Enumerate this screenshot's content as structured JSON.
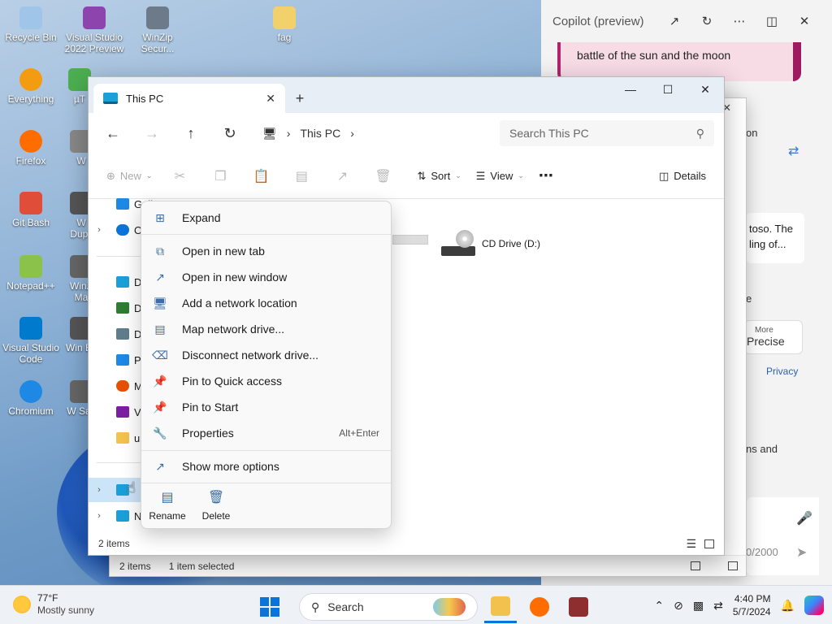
{
  "desktop": {
    "icons": [
      {
        "label": "Recycle Bin",
        "color": "#9fc5e8"
      },
      {
        "label": "Visual Studio 2022 Preview",
        "color": "#8e44ad"
      },
      {
        "label": "WinZip Secur...",
        "color": "#6c7a89"
      },
      {
        "label": "fag",
        "color": "#f2d16b"
      },
      {
        "label": "Everything",
        "color": "#f39c12"
      },
      {
        "label": "µT",
        "color": "#4caf50"
      },
      {
        "label": "Firefox",
        "color": "#ff6d00"
      },
      {
        "label": "W",
        "color": "#888888"
      },
      {
        "label": "Git Bash",
        "color": "#e04e39"
      },
      {
        "label": "W Dupli",
        "color": "#555555"
      },
      {
        "label": "Notepad++",
        "color": "#8bc34a"
      },
      {
        "label": "WinZ Ma",
        "color": "#666666"
      },
      {
        "label": "Visual Studio Code",
        "color": "#007acc"
      },
      {
        "label": "Win Ex",
        "color": "#555555"
      },
      {
        "label": "Chromium",
        "color": "#1e88e5"
      },
      {
        "label": "W Safi",
        "color": "#666666"
      }
    ]
  },
  "copilot": {
    "title": "Copilot (preview)",
    "message": "battle of the sun and the moon",
    "frag_on": "on",
    "frag_toso": "toso. The",
    "frag_ling": "ling of...",
    "frag_e": "e",
    "more_label": "More",
    "precise_label": "Precise",
    "privacy": "Privacy",
    "frag_ns": "ns and",
    "counter": "0/2000"
  },
  "background_window": {
    "status_items": "2 items",
    "status_selected": "1 item selected"
  },
  "explorer": {
    "tab_title": "This PC",
    "breadcrumb": "This PC",
    "search_placeholder": "Search This PC",
    "new_label": "New",
    "sort_label": "Sort",
    "view_label": "View",
    "details_label": "Details",
    "nav_items": [
      {
        "label": "Gall",
        "expander": "",
        "color": "#1e88e5"
      },
      {
        "label": "O",
        "expander": "›",
        "color": "#0a74da"
      },
      {
        "label": "D",
        "expander": "",
        "color": "#1b9fd8"
      },
      {
        "label": "D",
        "expander": "",
        "color": "#2e7d32"
      },
      {
        "label": "D",
        "expander": "",
        "color": "#607d8b"
      },
      {
        "label": "P",
        "expander": "",
        "color": "#1e88e5"
      },
      {
        "label": "M",
        "expander": "",
        "color": "#e65100"
      },
      {
        "label": "V",
        "expander": "",
        "color": "#7b1fa2"
      },
      {
        "label": "u",
        "expander": "",
        "color": "#f2c14e"
      },
      {
        "label": "",
        "expander": "›",
        "color": "#1b9fd8"
      },
      {
        "label": "N",
        "expander": "›",
        "color": "#1b9fd8"
      }
    ],
    "drive_label": "CD Drive (D:)",
    "status_items": "2 items"
  },
  "context_menu": {
    "expand": "Expand",
    "open_new_tab": "Open in new tab",
    "open_new_window": "Open in new window",
    "add_network_location": "Add a network location",
    "map_network_drive": "Map network drive...",
    "disconnect_network_drive": "Disconnect network drive...",
    "pin_quick_access": "Pin to Quick access",
    "pin_start": "Pin to Start",
    "properties": "Properties",
    "properties_shortcut": "Alt+Enter",
    "show_more_options": "Show more options",
    "rename": "Rename",
    "delete": "Delete"
  },
  "taskbar": {
    "weather_temp": "77°F",
    "weather_desc": "Mostly sunny",
    "search_label": "Search",
    "time": "4:40 PM",
    "date": "5/7/2024"
  }
}
